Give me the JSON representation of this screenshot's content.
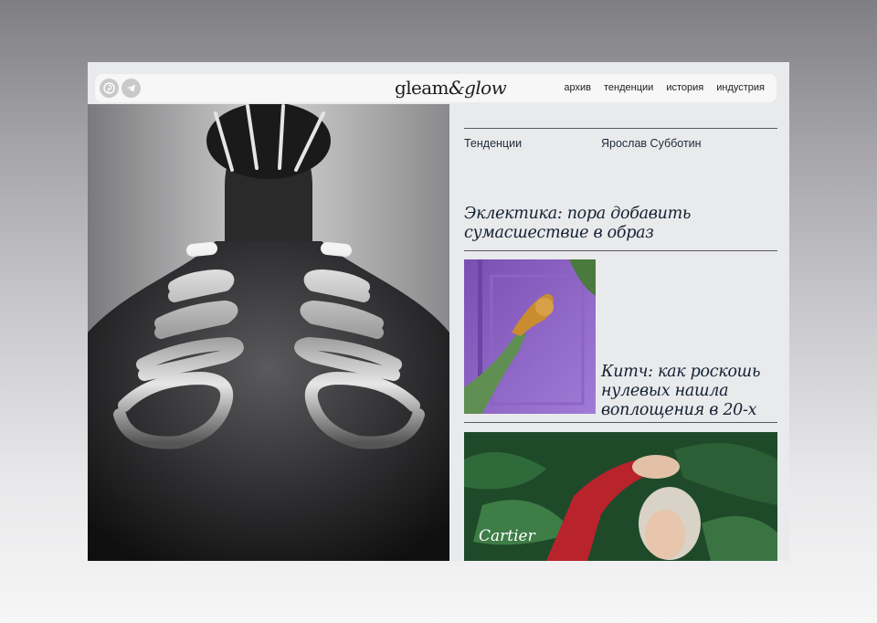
{
  "header": {
    "logo_main": "gleam",
    "logo_amp": "&",
    "logo_accent": "glow",
    "nav": [
      "архив",
      "тенденции",
      "история",
      "индустрия"
    ]
  },
  "article": {
    "category": "Тенденции",
    "author": "Ярослав Субботин",
    "title": "Эклектика: пора добавить сумасшествие в образ"
  },
  "card": {
    "title": "Китч: как роскошь нулевых нашла воплощения в 20-х"
  },
  "ad": {
    "brand": "Cartier"
  },
  "icons": {
    "social_1": "pinterest-icon",
    "social_2": "telegram-icon"
  }
}
